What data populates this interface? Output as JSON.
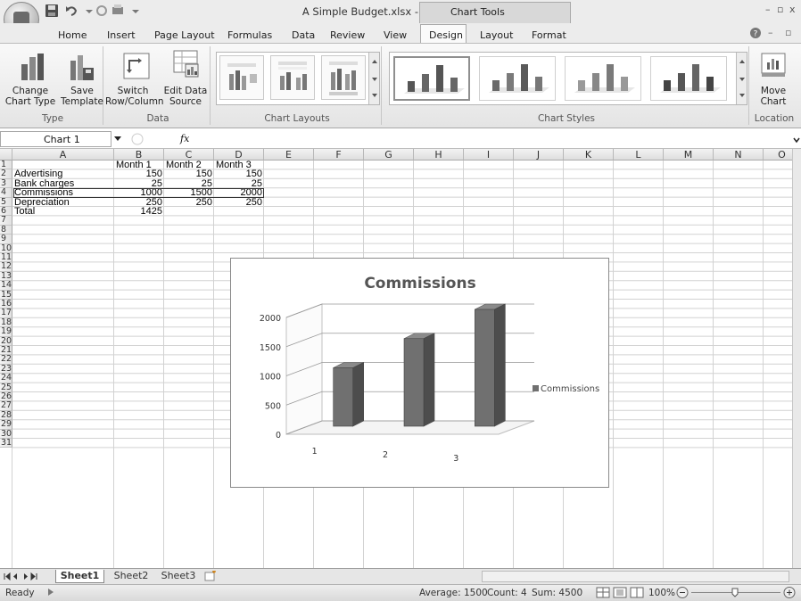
{
  "app": {
    "window_title": "A Simple Budget.xlsx - Microsoft Excel",
    "context_tab_title": "Chart Tools"
  },
  "tabs": [
    "Home",
    "Insert",
    "Page Layout",
    "Formulas",
    "Data",
    "Review",
    "View",
    "Design",
    "Layout",
    "Format"
  ],
  "active_tab": "Design",
  "ribbon": {
    "type_group": {
      "label": "Type",
      "change_chart_type_1": "Change",
      "change_chart_type_2": "Chart Type",
      "save_template_1": "Save",
      "save_template_2": "Template"
    },
    "data_group": {
      "label": "Data",
      "switch_1": "Switch",
      "switch_2": "Row/Column",
      "edit_data_1": "Edit Data",
      "edit_data_2": "Source"
    },
    "layouts_group": {
      "label": "Chart Layouts"
    },
    "styles_group": {
      "label": "Chart Styles"
    },
    "location_group": {
      "label": "Location",
      "move_1": "Move",
      "move_2": "Chart"
    }
  },
  "formula_bar": {
    "name_box": "Chart 1",
    "fx": "fx",
    "formula": ""
  },
  "columns": [
    "A",
    "B",
    "C",
    "D",
    "E",
    "F",
    "G",
    "H",
    "I",
    "J",
    "K",
    "L",
    "M",
    "N",
    "O"
  ],
  "rows": [
    "1",
    "2",
    "3",
    "4",
    "5",
    "6",
    "7",
    "8",
    "9",
    "10",
    "11",
    "12",
    "13",
    "14",
    "15",
    "16",
    "17",
    "18",
    "19",
    "20",
    "21",
    "22",
    "23",
    "24",
    "25",
    "26",
    "27",
    "28",
    "29",
    "30",
    "31"
  ],
  "cells": {
    "B1": "Month 1",
    "C1": "Month 2",
    "D1": "Month 3",
    "A2": "Advertising",
    "B2": "150",
    "C2": "150",
    "D2": "150",
    "A3": "Bank charges",
    "B3": "25",
    "C3": "25",
    "D3": "25",
    "A4": "Commissions",
    "B4": "1000",
    "C4": "1500",
    "D4": "2000",
    "A5": "Depreciation",
    "B5": "250",
    "C5": "250",
    "D5": "250",
    "A6": "Total",
    "B6": "1425"
  },
  "chart_data": {
    "type": "bar",
    "title": "Commissions",
    "categories": [
      "1",
      "2",
      "3"
    ],
    "series": [
      {
        "name": "Commissions",
        "values": [
          1000,
          1500,
          2000
        ]
      }
    ],
    "ylim": [
      0,
      2000
    ],
    "yticks": [
      "0",
      "500",
      "1000",
      "1500",
      "2000"
    ],
    "legend": "right",
    "grid": true,
    "colors": {
      "bar": "#7a7a7a"
    }
  },
  "sheet_tabs": [
    "Sheet1",
    "Sheet2",
    "Sheet3"
  ],
  "active_sheet": "Sheet1",
  "status": {
    "ready": "Ready",
    "average": "Average: 1500",
    "count": "Count: 4",
    "sum": "Sum: 4500",
    "zoom": "100%"
  }
}
